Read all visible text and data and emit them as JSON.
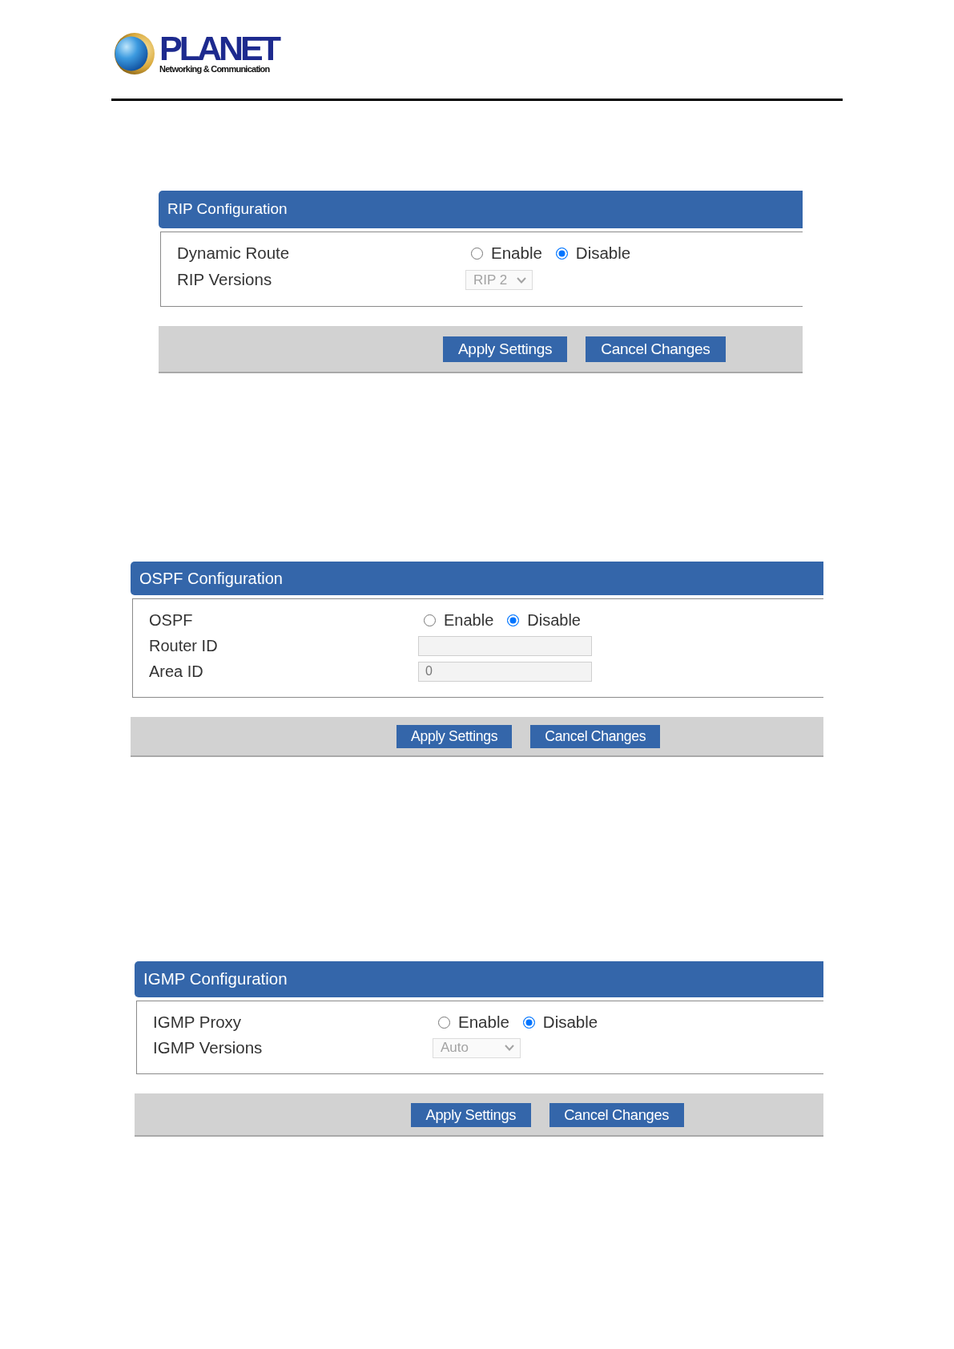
{
  "logo": {
    "brand": "PLANET",
    "tagline": "Networking & Communication"
  },
  "panels": [
    {
      "title": "RIP Configuration",
      "rows": [
        {
          "kind": "radio",
          "label": "Dynamic Route",
          "options": [
            {
              "label": "Enable",
              "selected": false
            },
            {
              "label": "Disable",
              "selected": true
            }
          ]
        },
        {
          "kind": "select",
          "label": "RIP Versions",
          "value": "RIP 2",
          "disabled": true
        }
      ],
      "buttons": [
        "Apply Settings",
        "Cancel Changes"
      ]
    },
    {
      "title": "OSPF Configuration",
      "rows": [
        {
          "kind": "radio",
          "label": "OSPF",
          "options": [
            {
              "label": "Enable",
              "selected": false
            },
            {
              "label": "Disable",
              "selected": true
            }
          ]
        },
        {
          "kind": "text",
          "label": "Router ID",
          "disabled": true
        },
        {
          "kind": "text",
          "label": "Area ID",
          "value": "0",
          "disabled": true
        }
      ],
      "buttons": [
        "Apply Settings",
        "Cancel Changes"
      ]
    },
    {
      "title": "IGMP Configuration",
      "rows": [
        {
          "kind": "radio",
          "label": "IGMP Proxy",
          "options": [
            {
              "label": "Enable",
              "selected": false
            },
            {
              "label": "Disable",
              "selected": true
            }
          ]
        },
        {
          "kind": "select",
          "label": "IGMP Versions",
          "value": "Auto",
          "disabled": true
        }
      ],
      "buttons": [
        "Apply Settings",
        "Cancel Changes"
      ]
    }
  ]
}
